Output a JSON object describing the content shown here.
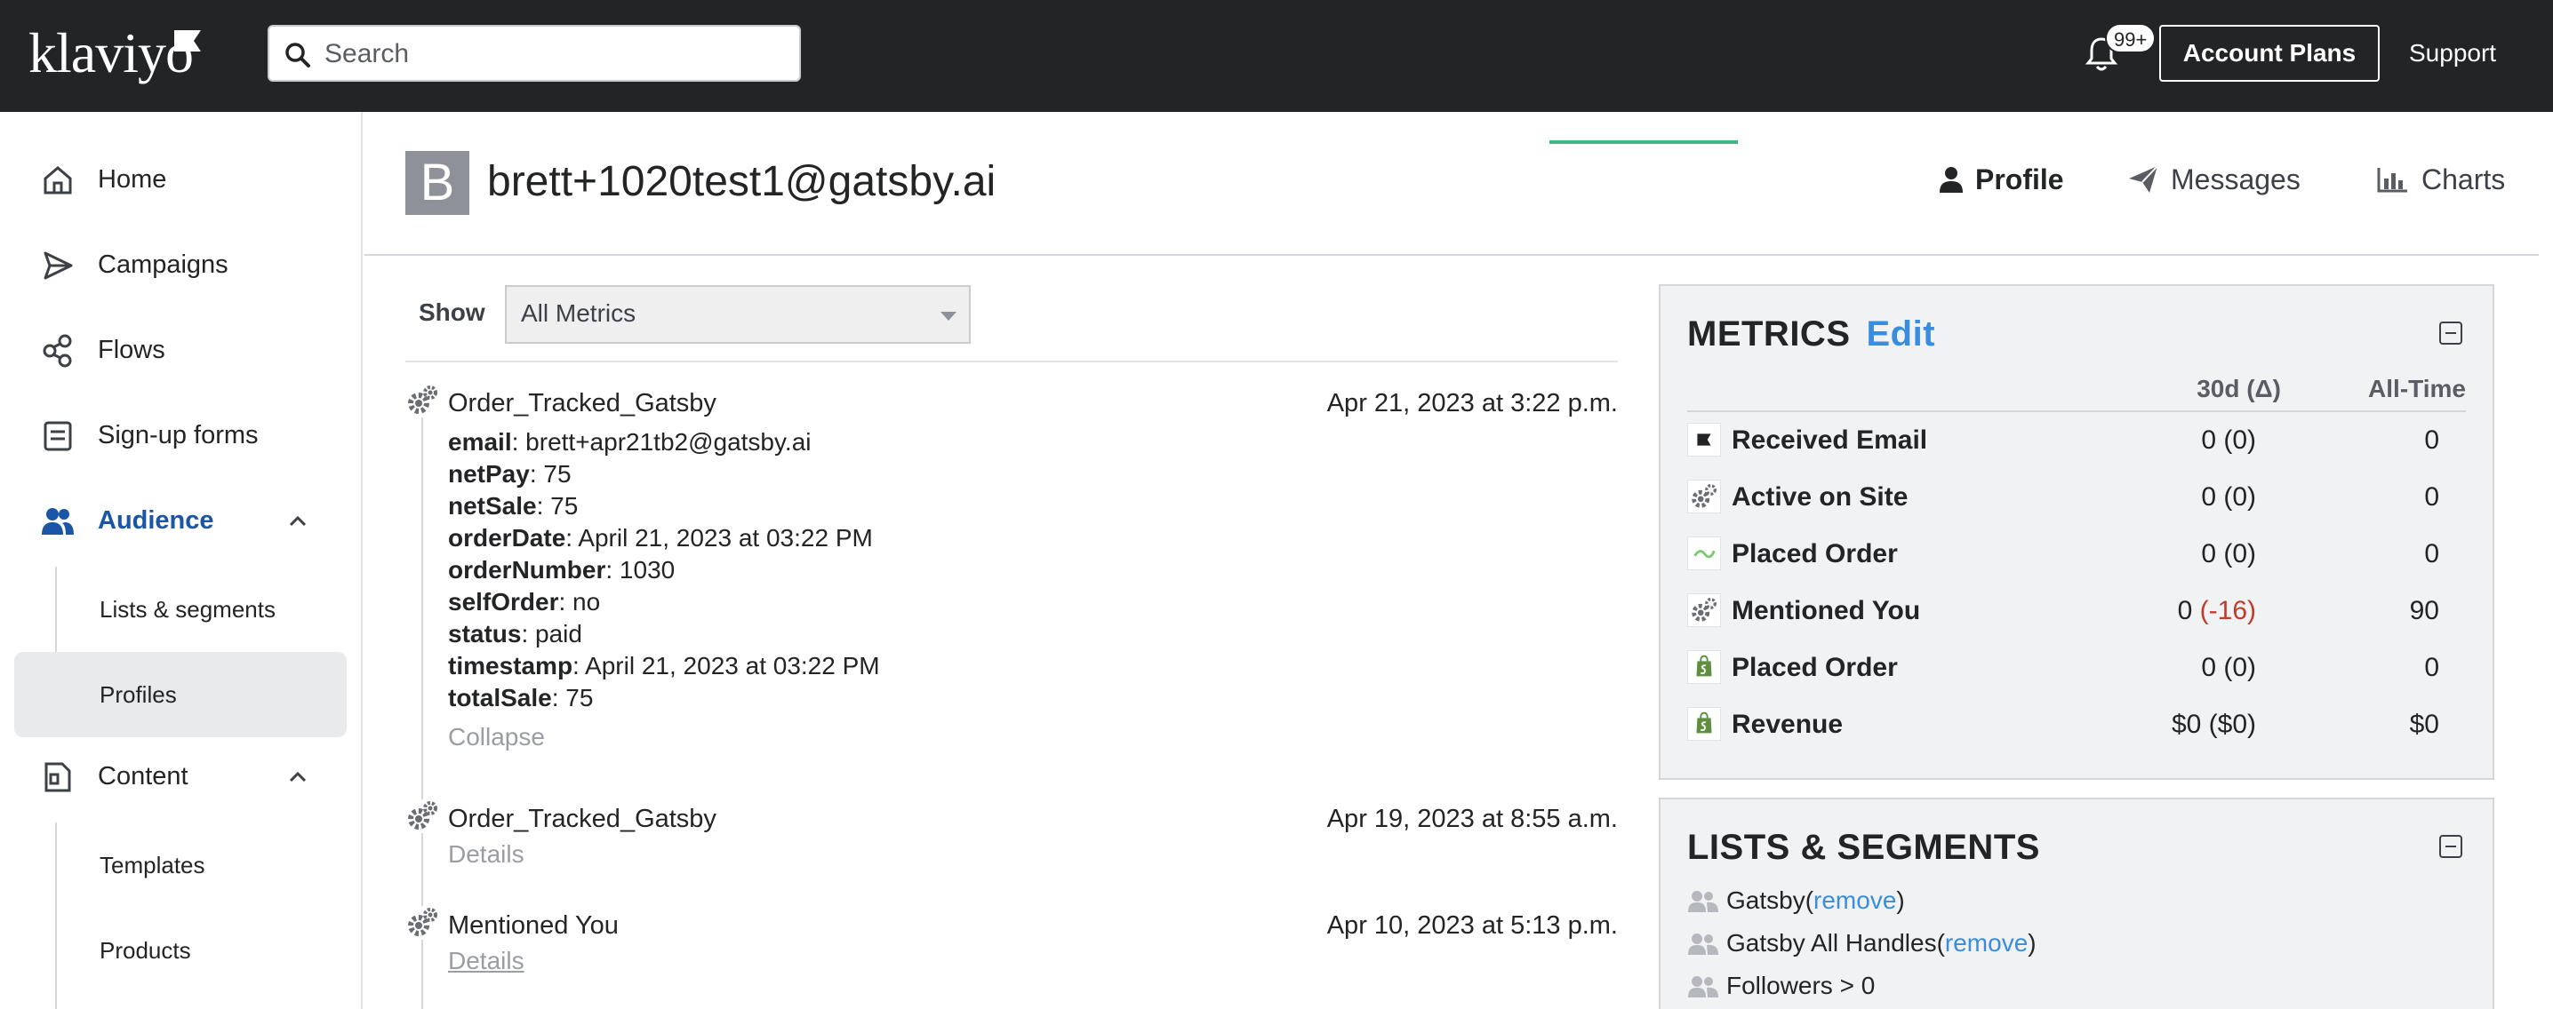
{
  "topbar": {
    "logo": "klaviyo",
    "search_placeholder": "Search",
    "notification_badge": "99+",
    "account_plans": "Account Plans",
    "support": "Support"
  },
  "sidebar": {
    "items": [
      {
        "label": "Home",
        "icon": "home-icon"
      },
      {
        "label": "Campaigns",
        "icon": "send-icon"
      },
      {
        "label": "Flows",
        "icon": "flows-icon"
      },
      {
        "label": "Sign-up forms",
        "icon": "form-icon"
      },
      {
        "label": "Audience",
        "icon": "audience-icon"
      },
      {
        "label": "Content",
        "icon": "content-icon"
      }
    ],
    "audience_sub": [
      {
        "label": "Lists & segments"
      },
      {
        "label": "Profiles"
      }
    ],
    "content_sub": [
      {
        "label": "Templates"
      },
      {
        "label": "Products"
      }
    ]
  },
  "header": {
    "avatar_initial": "B",
    "profile_email": "brett+1020test1@gatsby.ai",
    "tabs": [
      {
        "label": "Profile",
        "icon": "person-icon"
      },
      {
        "label": "Messages",
        "icon": "paper-plane-icon"
      },
      {
        "label": "Charts",
        "icon": "bar-chart-icon"
      }
    ]
  },
  "feed": {
    "show_label": "Show",
    "filter_value": "All Metrics",
    "events": [
      {
        "name": "Order_Tracked_Gatsby",
        "date": "Apr 21, 2023 at 3:22 p.m.",
        "properties": [
          {
            "key": "email",
            "value": ": brett+apr21tb2@gatsby.ai"
          },
          {
            "key": "netPay",
            "value": ": 75"
          },
          {
            "key": "netSale",
            "value": ": 75"
          },
          {
            "key": "orderDate",
            "value": ": April 21, 2023 at 03:22 PM"
          },
          {
            "key": "orderNumber",
            "value": ": 1030"
          },
          {
            "key": "selfOrder",
            "value": ": no"
          },
          {
            "key": "status",
            "value": ": paid"
          },
          {
            "key": "timestamp",
            "value": ": April 21, 2023 at 03:22 PM"
          },
          {
            "key": "totalSale",
            "value": ": 75"
          }
        ],
        "toggle": "Collapse"
      },
      {
        "name": "Order_Tracked_Gatsby",
        "date": "Apr 19, 2023 at 8:55 a.m.",
        "toggle": "Details"
      },
      {
        "name": "Mentioned You",
        "date": "Apr 10, 2023 at 5:13 p.m.",
        "toggle": "Details"
      }
    ]
  },
  "metrics": {
    "title": "METRICS",
    "edit": "Edit",
    "col_30d": "30d (Δ)",
    "col_all": "All-Time",
    "rows": [
      {
        "name": "Received Email",
        "icon": "klaviyo-flag-icon",
        "d30": "0 (0)",
        "delta_neg": "",
        "d30_close": "",
        "all": "0"
      },
      {
        "name": "Active on Site",
        "icon": "gear-icon",
        "d30": "0 (0)",
        "delta_neg": "",
        "d30_close": "",
        "all": "0"
      },
      {
        "name": "Placed Order",
        "icon": "gatsby-icon",
        "d30": "0 (0)",
        "delta_neg": "",
        "d30_close": "",
        "all": "0"
      },
      {
        "name": "Mentioned You",
        "icon": "gear-icon",
        "d30": "0 ",
        "delta_neg": "(-16)",
        "d30_close": "",
        "all": "90"
      },
      {
        "name": "Placed Order",
        "icon": "shopify-icon",
        "d30": "0 (0)",
        "delta_neg": "",
        "d30_close": "",
        "all": "0"
      },
      {
        "name": "Revenue",
        "icon": "shopify-icon",
        "d30": "$0 ($0)",
        "delta_neg": "",
        "d30_close": "",
        "all": "$0"
      }
    ],
    "accent_color": "#3a8dde",
    "negative_color": "#c23a2a"
  },
  "lists": {
    "title": "LISTS & SEGMENTS",
    "items": [
      {
        "name": "Gatsby",
        "open": " (",
        "action": "remove",
        "close": ")"
      },
      {
        "name": "Gatsby All Handles",
        "open": " (",
        "action": "remove",
        "close": ")"
      },
      {
        "name": "Followers > 0",
        "open": "",
        "action": "",
        "close": ""
      }
    ]
  }
}
